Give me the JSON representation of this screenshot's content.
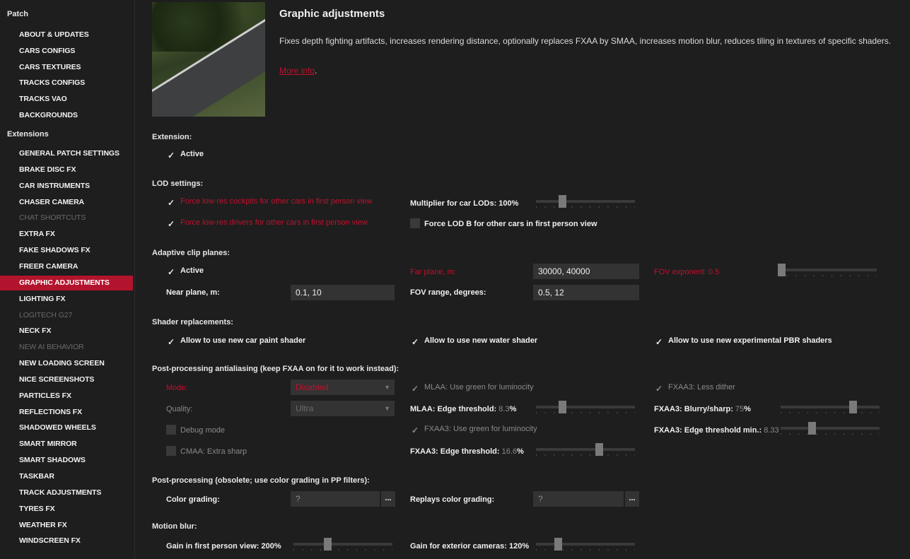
{
  "sidebar": {
    "patch_header": "Patch",
    "patch_items": [
      "ABOUT & UPDATES",
      "CARS CONFIGS",
      "CARS TEXTURES",
      "TRACKS CONFIGS",
      "TRACKS VAO",
      "BACKGROUNDS"
    ],
    "extensions_header": "Extensions",
    "extension_items": [
      "GENERAL PATCH SETTINGS",
      "BRAKE DISC FX",
      "CAR INSTRUMENTS",
      "CHASER CAMERA",
      "CHAT SHORTCUTS",
      "EXTRA FX",
      "FAKE SHADOWS FX",
      "FREER CAMERA",
      "GRAPHIC ADJUSTMENTS",
      "LIGHTING FX",
      "LOGITECH G27",
      "NECK FX",
      "NEW AI BEHAVIOR",
      "NEW LOADING SCREEN",
      "NICE SCREENSHOTS",
      "PARTICLES FX",
      "REFLECTIONS FX",
      "SHADOWED WHEELS",
      "SMART MIRROR",
      "SMART SHADOWS",
      "TASKBAR",
      "TRACK ADJUSTMENTS",
      "TYRES FX",
      "WEATHER FX",
      "WINDSCREEN FX"
    ],
    "disabled_items": [
      "CHAT SHORTCUTS",
      "LOGITECH G27",
      "NEW AI BEHAVIOR"
    ],
    "selected_item": "GRAPHIC ADJUSTMENTS"
  },
  "header": {
    "title": "Graphic adjustments",
    "description": "Fixes depth fighting artifacts, increases rendering distance, optionally replaces FXAA by SMAA, increases motion blur, reduces tiling in textures of specific shaders.",
    "more_info": "More info"
  },
  "extension": {
    "section": "Extension:",
    "active_label": "Active",
    "active": true
  },
  "lod": {
    "section": "LOD settings:",
    "low_res_cockpits": "Force low-res cockpits for other cars in first person view",
    "low_res_drivers": "Force low-res drivers for other cars in first person view",
    "multiplier_label": "Multiplier for car LODs: 100%",
    "multiplier_value": 0.25,
    "force_lod_b": "Force LOD B for other cars in first person view"
  },
  "clip": {
    "section": "Adaptive clip planes:",
    "active_label": "Active",
    "near_label": "Near plane, m:",
    "near_value": "0.1, 10",
    "far_label": "Far plane, m:",
    "far_value": "30000, 40000",
    "fov_range_label": "FOV range, degrees:",
    "fov_range_value": "0.5, 12",
    "fov_exponent_label": "FOV exponent: 0.5",
    "fov_exponent_value": 0.0
  },
  "shaders": {
    "section": "Shader replacements:",
    "car_paint": "Allow to use new car paint shader",
    "water": "Allow to use new water shader",
    "pbr": "Allow to use new experimental PBR shaders"
  },
  "aa": {
    "section": "Post-processing antialiasing (keep FXAA on for it to work instead):",
    "mode_label": "Mode:",
    "mode_value": "Disabled",
    "quality_label": "Quality:",
    "quality_value": "Ultra",
    "debug_mode": "Debug mode",
    "cmaa_sharp": "CMAA: Extra sharp",
    "mlaa_green": "MLAA: Use green for luminocity",
    "mlaa_edge_label": "MLAA: Edge threshold:",
    "mlaa_edge_value": "8.3",
    "mlaa_edge_level": 0.25,
    "fxaa_green": "FXAA3: Use green for luminocity",
    "fxaa_edge_label": "FXAA3: Edge threshold:",
    "fxaa_edge_value": "16.6",
    "fxaa_edge_level": 0.65,
    "fxaa_dither": "FXAA3: Less dither",
    "fxaa_blurry_label": "FXAA3: Blurry/sharp:",
    "fxaa_blurry_value": "75",
    "fxaa_blurry_level": 0.75,
    "fxaa_edge_min_label": "FXAA3: Edge threshold min.:",
    "fxaa_edge_min_value": "8.33",
    "fxaa_edge_min_level": 0.3,
    "percent": "%"
  },
  "pp": {
    "section": "Post-processing (obsolete; use color grading in PP filters):",
    "color_grading_label": "Color grading:",
    "color_grading_value": "?",
    "replays_label": "Replays color grading:",
    "replays_value": "?",
    "ellipsis": "..."
  },
  "motion": {
    "section": "Motion blur:",
    "first_person_label": "Gain in first person view: 200%",
    "first_person_level": 0.33,
    "exterior_label": "Gain for exterior cameras: 120%",
    "exterior_level": 0.2
  }
}
